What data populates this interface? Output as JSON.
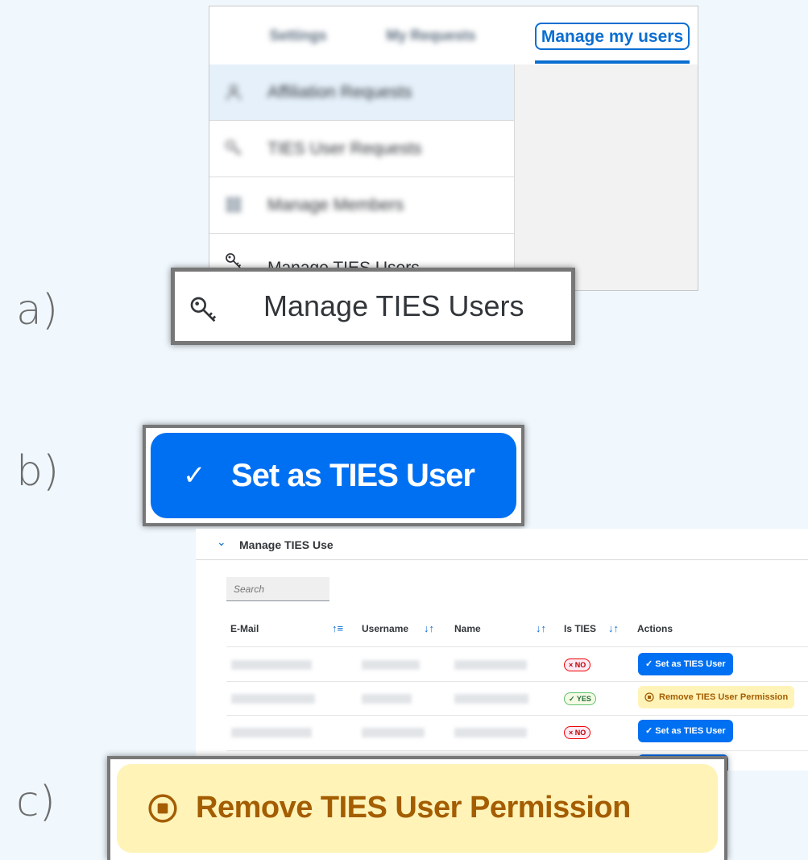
{
  "panel_labels": {
    "a": "a)",
    "b": "b)",
    "c": "c)"
  },
  "panel_a": {
    "tabs": [
      {
        "label": "Settings"
      },
      {
        "label": "My Requests"
      },
      {
        "label": "Manage my users"
      }
    ],
    "menu_items": [
      {
        "label": "Affiliation Requests",
        "icon": "person-icon"
      },
      {
        "label": "TIES User Requests",
        "icon": "key-icon"
      },
      {
        "label": "Manage Members",
        "icon": "table-icon"
      },
      {
        "label": "Manage TIES Users",
        "icon": "key-icon"
      }
    ],
    "zoom_label": "Manage TIES Users"
  },
  "panel_b": {
    "button_check": "✓",
    "button_label": "Set as TIES User"
  },
  "table": {
    "section_title": "Manage TIES Use",
    "search_placeholder": "Search",
    "columns": [
      {
        "label": "E-Mail",
        "sort": "↑≡"
      },
      {
        "label": "Username",
        "sort": "↓↑"
      },
      {
        "label": "Name",
        "sort": "↓↑"
      },
      {
        "label": "Is TIES",
        "sort": "↓↑"
      },
      {
        "label": "Actions"
      }
    ],
    "rows": [
      {
        "is_ties": "× NO",
        "status": "no",
        "action": "✓  Set as TIES User"
      },
      {
        "is_ties": "✓ YES",
        "status": "yes",
        "action": "Remove TIES User Permission"
      },
      {
        "is_ties": "× NO",
        "status": "no",
        "action": "✓  Set as TIES User"
      }
    ]
  },
  "panel_c": {
    "button_label": "Remove TIES User Permission"
  },
  "colors": {
    "background": "#f0f8fe",
    "accent_blue": "#0070f2",
    "warning_bg": "#fff3b8",
    "warning_text": "#a45d00"
  }
}
